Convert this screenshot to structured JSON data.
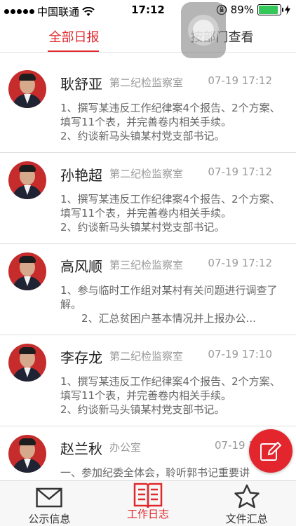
{
  "status_bar": {
    "carrier": "中国联通",
    "time": "17:12",
    "battery_percent": "89%",
    "battery_level": 0.89
  },
  "tabs": [
    {
      "label": "全部日报",
      "active": true
    },
    {
      "label": "按部门查看",
      "active": false
    }
  ],
  "reports": [
    {
      "name": "耿舒亚",
      "department": "第二纪检监察室",
      "time": "07-19 17:12",
      "line1": "1、撰写某违反工作纪律案4个报告、2个方案、填写11个表，并完善卷内相关手续。",
      "line2": "2、约谈新马头镇某村党支部书记。"
    },
    {
      "name": "孙艳超",
      "department": "第二纪检监察室",
      "time": "07-19 17:12",
      "line1": "1、撰写某违反工作纪律案4个报告、2个方案、填写11个表，并完善卷内相关手续。",
      "line2": "2、约谈新马头镇某村党支部书记。"
    },
    {
      "name": "高风顺",
      "department": "第三纪检监察室",
      "time": "07-19 17:12",
      "line1": "1、参与临时工作组对某村有关问题进行调查了解。",
      "line2": "2、汇总贫困户基本情况并上报办公..."
    },
    {
      "name": "李存龙",
      "department": "第二纪检监察室",
      "time": "07-19 17:10",
      "line1": "1、撰写某违反工作纪律案4个报告、2个方案、填写11个表，并完善卷内相关手续。",
      "line2": "2、约谈新马头镇某村党支部书记。"
    },
    {
      "name": "赵兰秋",
      "department": "办公室",
      "time": "07-19 17:0",
      "line1": "一、参加纪委全体会，聆听郭书记重要讲",
      "line2": ""
    }
  ],
  "bottom_nav": [
    {
      "label": "公示信息",
      "icon": "mail-icon",
      "active": false
    },
    {
      "label": "工作日志",
      "icon": "book-icon",
      "active": true
    },
    {
      "label": "文件汇总",
      "icon": "star-icon",
      "active": false
    }
  ],
  "colors": {
    "accent": "#e0282c",
    "avatar_bg": "#c62c2c",
    "fab_bg": "#e3262d"
  }
}
